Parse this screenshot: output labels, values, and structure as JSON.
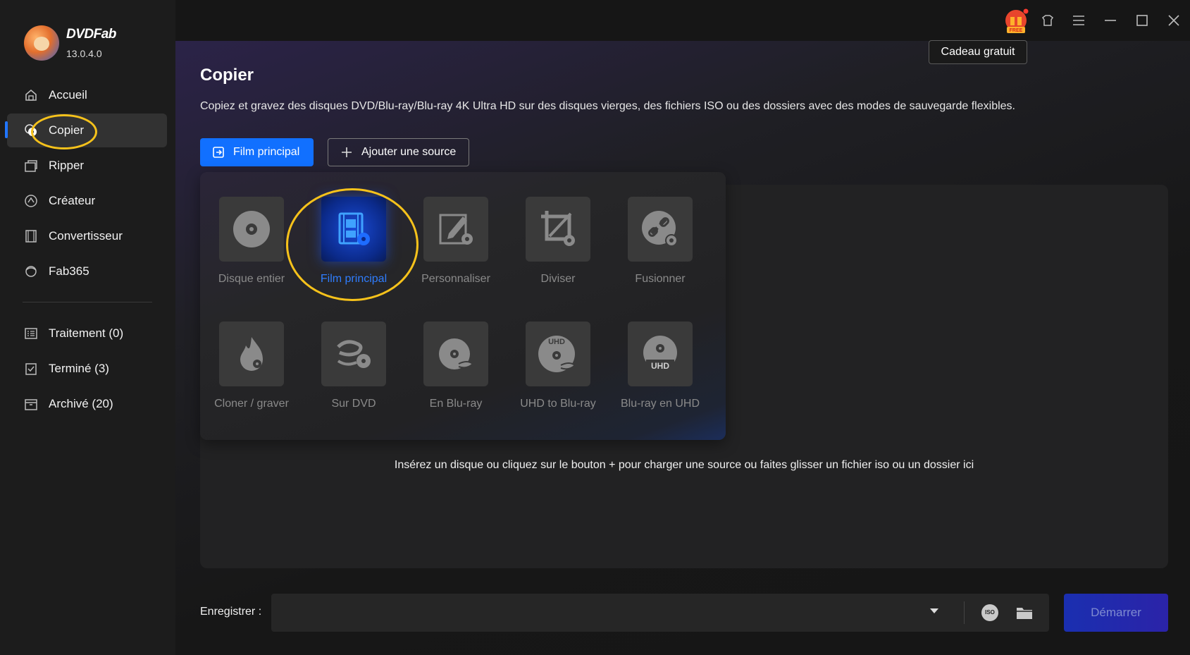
{
  "app": {
    "brand": "DVDFab",
    "version": "13.0.4.0"
  },
  "sidebar": {
    "items": [
      {
        "label": "Accueil",
        "icon": "home-icon"
      },
      {
        "label": "Copier",
        "icon": "copy-disc-icon"
      },
      {
        "label": "Ripper",
        "icon": "ripper-icon"
      },
      {
        "label": "Créateur",
        "icon": "creator-icon"
      },
      {
        "label": "Convertisseur",
        "icon": "converter-icon"
      },
      {
        "label": "Fab365",
        "icon": "fab365-icon"
      }
    ],
    "queue": [
      {
        "label": "Traitement (0)",
        "icon": "processing-list-icon"
      },
      {
        "label": "Terminé (3)",
        "icon": "finished-list-icon"
      },
      {
        "label": "Archivé (20)",
        "icon": "archive-icon"
      }
    ]
  },
  "titlebar": {
    "gift_badge": "FREE",
    "tooltip": "Cadeau gratuit"
  },
  "page": {
    "title": "Copier",
    "description": "Copiez et gravez des disques DVD/Blu-ray/Blu-ray 4K Ultra HD sur des disques vierges, des fichiers ISO ou des dossiers avec des modes de sauvegarde flexibles.",
    "mode_button": "Film principal",
    "add_source_button": "Ajouter une source",
    "drop_hint": "Insérez un disque ou cliquez sur le bouton +  pour charger une source ou faites glisser un fichier iso ou un dossier ici"
  },
  "modes": [
    {
      "label": "Disque entier",
      "icon": "full-disc-icon"
    },
    {
      "label": "Film principal",
      "icon": "main-movie-icon",
      "selected": true
    },
    {
      "label": "Personnaliser",
      "icon": "customize-icon"
    },
    {
      "label": "Diviser",
      "icon": "split-icon"
    },
    {
      "label": "Fusionner",
      "icon": "merge-icon"
    },
    {
      "label": "Cloner / graver",
      "icon": "clone-burn-icon"
    },
    {
      "label": "Sur DVD",
      "icon": "to-dvd-icon"
    },
    {
      "label": "En Blu-ray",
      "icon": "to-bluray-icon"
    },
    {
      "label": "UHD to Blu-ray",
      "icon": "uhd-to-bluray-icon",
      "badge": "UHD"
    },
    {
      "label": "Blu-ray en UHD",
      "icon": "bluray-to-uhd-icon",
      "badge": "UHD"
    }
  ],
  "footer": {
    "save_label": "Enregistrer :",
    "iso_label": "ISO",
    "start_button": "Démarrer"
  },
  "colors": {
    "accent": "#1170ff",
    "highlight": "#f6c21b",
    "selected_text": "#2f7dff"
  }
}
